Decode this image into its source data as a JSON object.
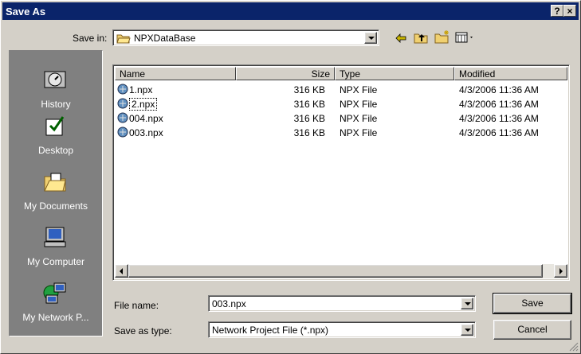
{
  "window": {
    "title": "Save As",
    "help_label": "?",
    "close_label": "×"
  },
  "toolbar": {
    "save_in_label": "Save in:",
    "save_in_value": "NPXDataBase",
    "icons": [
      "back-icon",
      "up-folder-icon",
      "new-folder-icon",
      "view-menu-icon"
    ]
  },
  "places": [
    {
      "label": "History",
      "icon": "history-icon"
    },
    {
      "label": "Desktop",
      "icon": "desktop-icon"
    },
    {
      "label": "My Documents",
      "icon": "my-documents-icon"
    },
    {
      "label": "My Computer",
      "icon": "my-computer-icon"
    },
    {
      "label": "My Network P...",
      "icon": "my-network-places-icon"
    }
  ],
  "columns": [
    "Name",
    "Size",
    "Type",
    "Modified"
  ],
  "files": [
    {
      "name": "1.npx",
      "size": "316 KB",
      "type": "NPX File",
      "modified": "4/3/2006 11:36 AM"
    },
    {
      "name": "2.npx",
      "size": "316 KB",
      "type": "NPX File",
      "modified": "4/3/2006 11:36 AM"
    },
    {
      "name": "004.npx",
      "size": "316 KB",
      "type": "NPX File",
      "modified": "4/3/2006 11:36 AM"
    },
    {
      "name": "003.npx",
      "size": "316 KB",
      "type": "NPX File",
      "modified": "4/3/2006 11:36 AM"
    }
  ],
  "form": {
    "file_name_label": "File name:",
    "file_name_value": "003.npx",
    "type_label": "Save as type:",
    "type_value": "Network Project File (*.npx)",
    "save_label": "Save",
    "cancel_label": "Cancel"
  }
}
